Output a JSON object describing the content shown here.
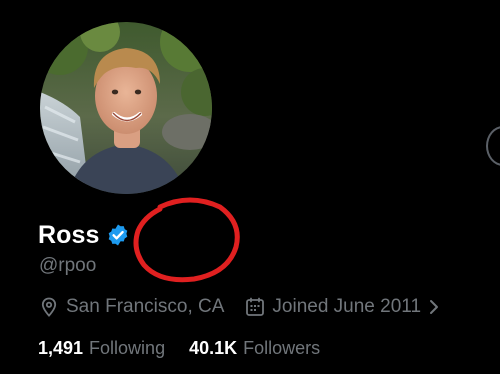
{
  "profile": {
    "display_name": "Ross",
    "handle": "@rpoo",
    "verified": true
  },
  "meta": {
    "location": "San Francisco, CA",
    "joined": "Joined June 2011"
  },
  "stats": {
    "following_count": "1,491",
    "following_label": "Following",
    "followers_count": "40.1K",
    "followers_label": "Followers"
  },
  "colors": {
    "background": "#000000",
    "primary_text": "#ffffff",
    "secondary_text": "#71767b",
    "verified_badge": "#1d9bf0",
    "annotation": "#e02020"
  },
  "icons": {
    "verified": "verified-badge-icon",
    "location": "location-pin-icon",
    "calendar": "calendar-icon",
    "chevron": "chevron-right-icon"
  }
}
